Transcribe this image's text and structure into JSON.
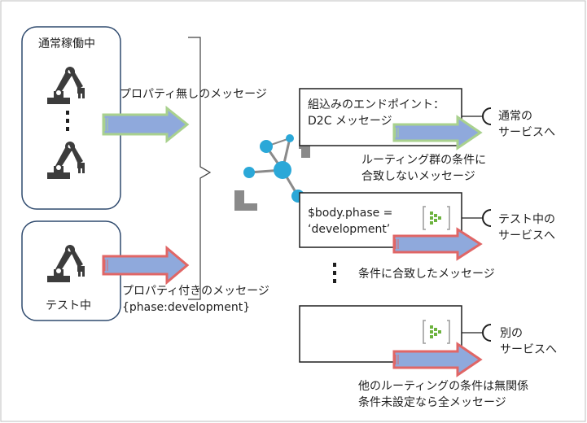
{
  "devices": {
    "normal_group_title": "通常稼働中",
    "test_group_title": "テスト中"
  },
  "messages": {
    "without_property": "プロパティ無しのメッセージ",
    "with_property_line1": "プロパティ付きのメッセージ",
    "with_property_line2": "{phase:development}"
  },
  "routes": {
    "builtin_line1": "組込みのエンドポイント：",
    "builtin_line2": "D2C メッセージ",
    "unmatched_line1": "ルーティング群の条件に",
    "unmatched_line2": "合致しないメッセージ",
    "condition_line1": "$body.phase =",
    "condition_line2": "‘development’",
    "matched_label": "条件に合致したメッセージ",
    "other_note_line1": "他のルーティングの条件は無関係",
    "other_note_line2": "条件未設定なら全メッセージ"
  },
  "services": {
    "normal_line1": "通常の",
    "normal_line2": "サービスへ",
    "test_line1": "テスト中の",
    "test_line2": "サービスへ",
    "other_line1": "別の",
    "other_line2": "サービスへ"
  },
  "colors": {
    "group_border": "#2f4a6e",
    "arrow_fill": "#8fa9dc",
    "arrow_green": "#a9d18e",
    "arrow_red": "#e06666",
    "hub_blue": "#2ba8d8",
    "hub_gray": "#8a8a8a",
    "robot": "#3c3c3c",
    "endpoint_green": "#6db33f"
  },
  "icons": {
    "robot": "robot-arm-icon",
    "hub": "iot-hub-icon",
    "endpoint": "event-hub-icon",
    "connector": "service-connector-icon"
  }
}
